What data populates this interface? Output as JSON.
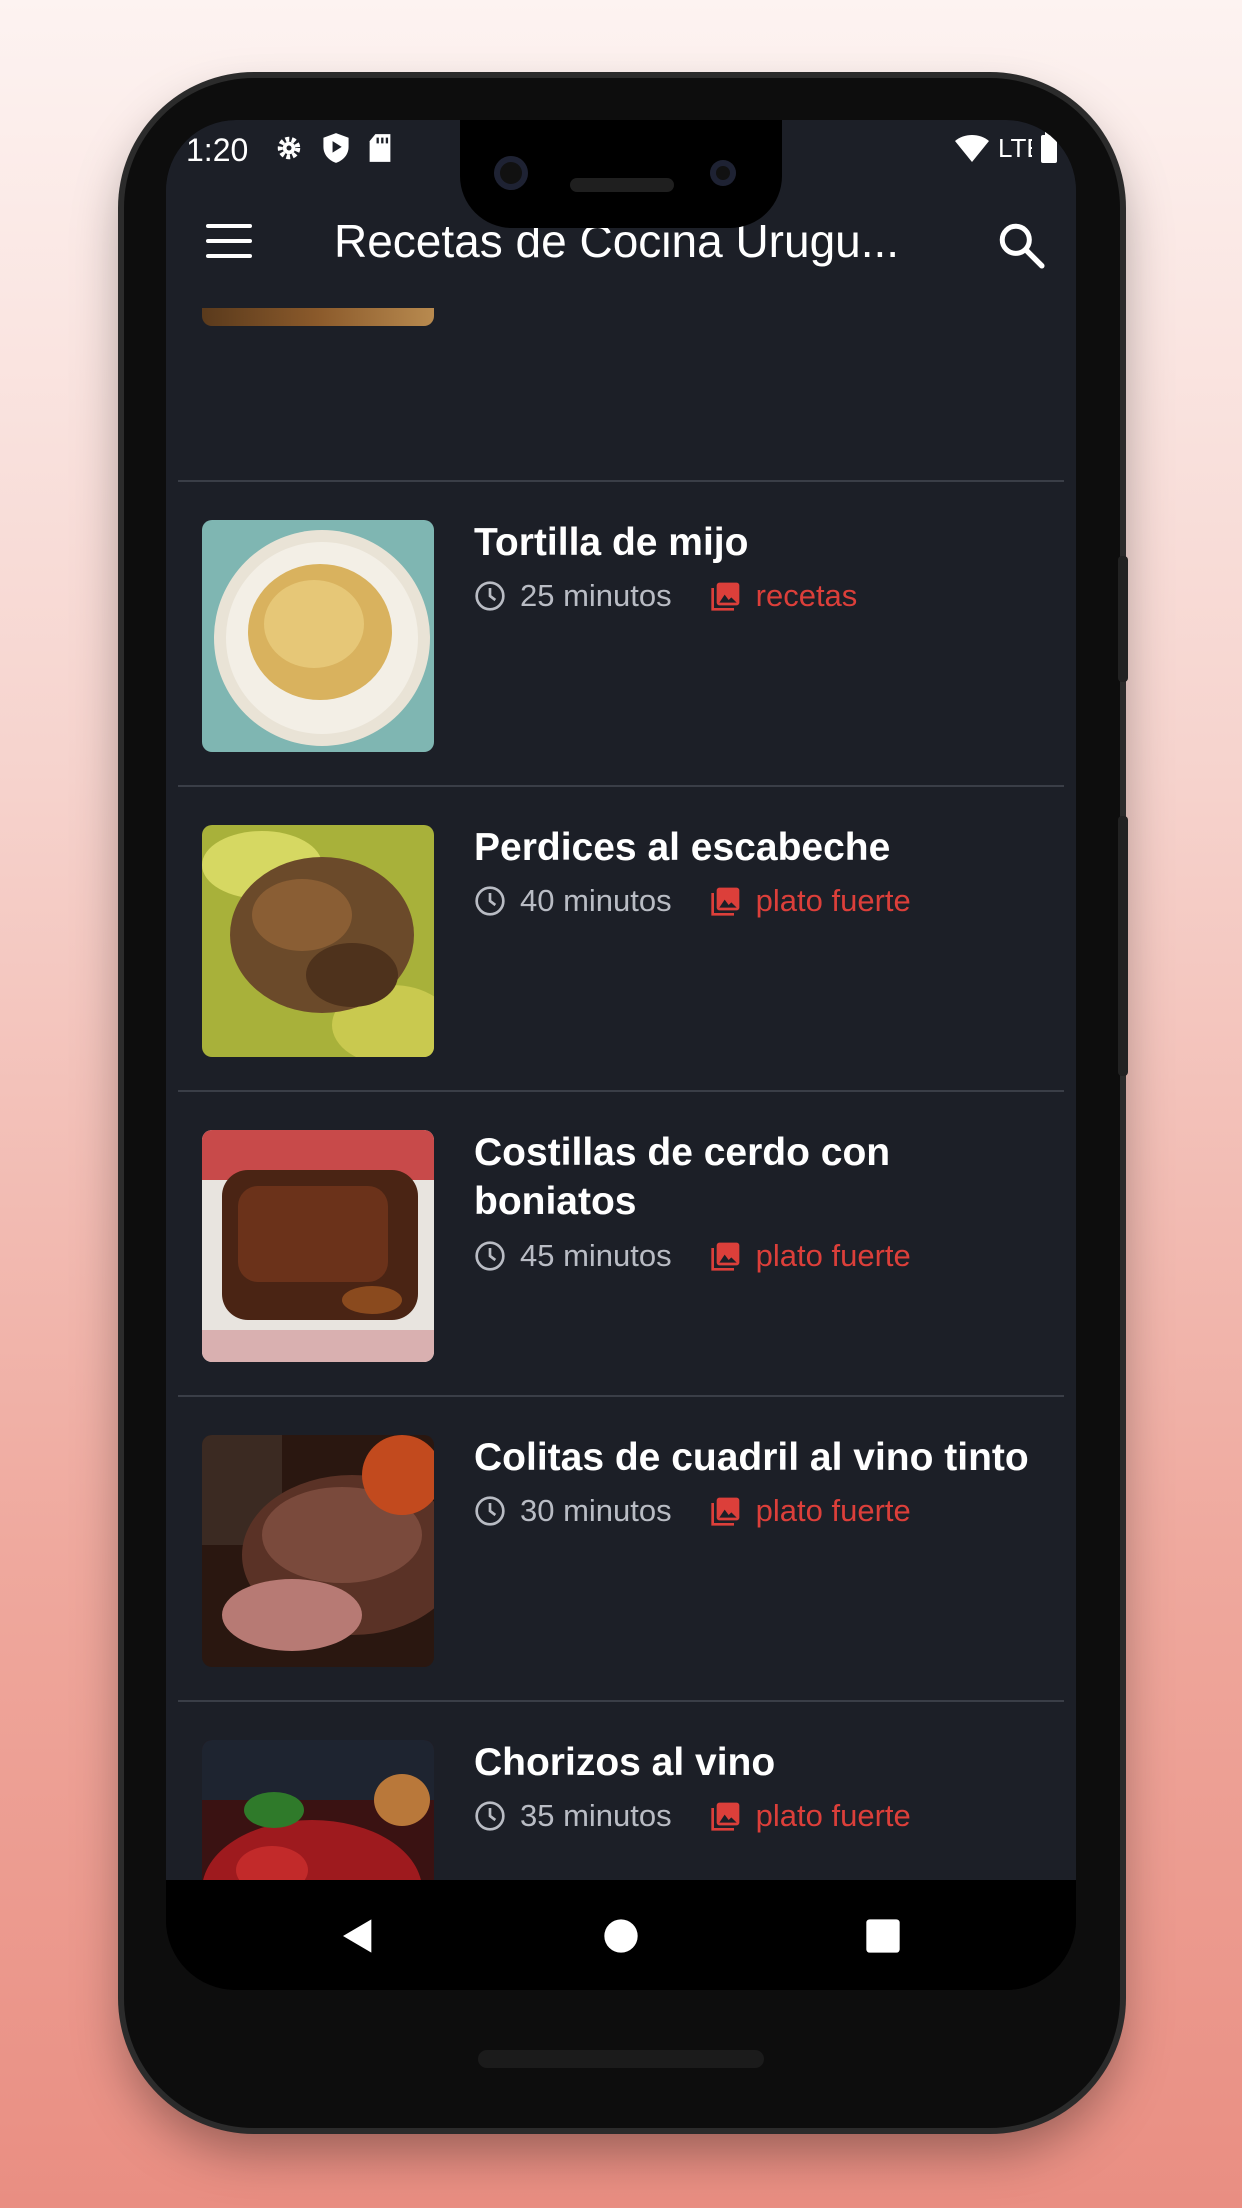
{
  "status_bar": {
    "time": "1:20",
    "network": "LTE"
  },
  "toolbar": {
    "title": "Recetas de Cocina Urugu..."
  },
  "icons": {
    "menu": "menu-icon",
    "search": "search-icon",
    "clock": "clock-icon",
    "category": "image-icon"
  },
  "colors": {
    "background": "#1c1f27",
    "accent": "#dc3f3a",
    "text": "#ffffff",
    "muted": "#b9bcc4"
  },
  "recipes": [
    {
      "title": "Tortilla de mijo",
      "time": "25 minutos",
      "category": "recetas"
    },
    {
      "title": "Perdices al escabeche",
      "time": "40 minutos",
      "category": "plato fuerte"
    },
    {
      "title": "Costillas de cerdo con boniatos",
      "time": "45 minutos",
      "category": "plato fuerte"
    },
    {
      "title": "Colitas de cuadril al vino tinto",
      "time": "30 minutos",
      "category": "plato fuerte"
    },
    {
      "title": "Chorizos al vino",
      "time": "35 minutos",
      "category": "plato fuerte"
    }
  ]
}
